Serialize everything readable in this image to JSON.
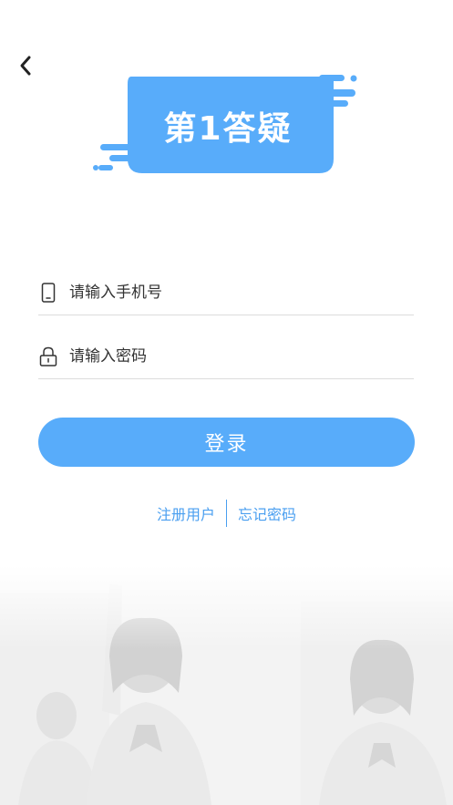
{
  "nav": {
    "back_icon": "chevron-left-icon"
  },
  "logo": {
    "text": "第1答疑",
    "color": "#58acfa"
  },
  "phone_field": {
    "placeholder": "请输入手机号",
    "icon": "phone-icon"
  },
  "password_field": {
    "placeholder": "请输入密码",
    "icon": "lock-icon"
  },
  "login_button": {
    "label": "登录",
    "color": "#58acfa"
  },
  "links": {
    "register": "注册用户",
    "forgot": "忘记密码",
    "color": "#4a9ff0"
  }
}
